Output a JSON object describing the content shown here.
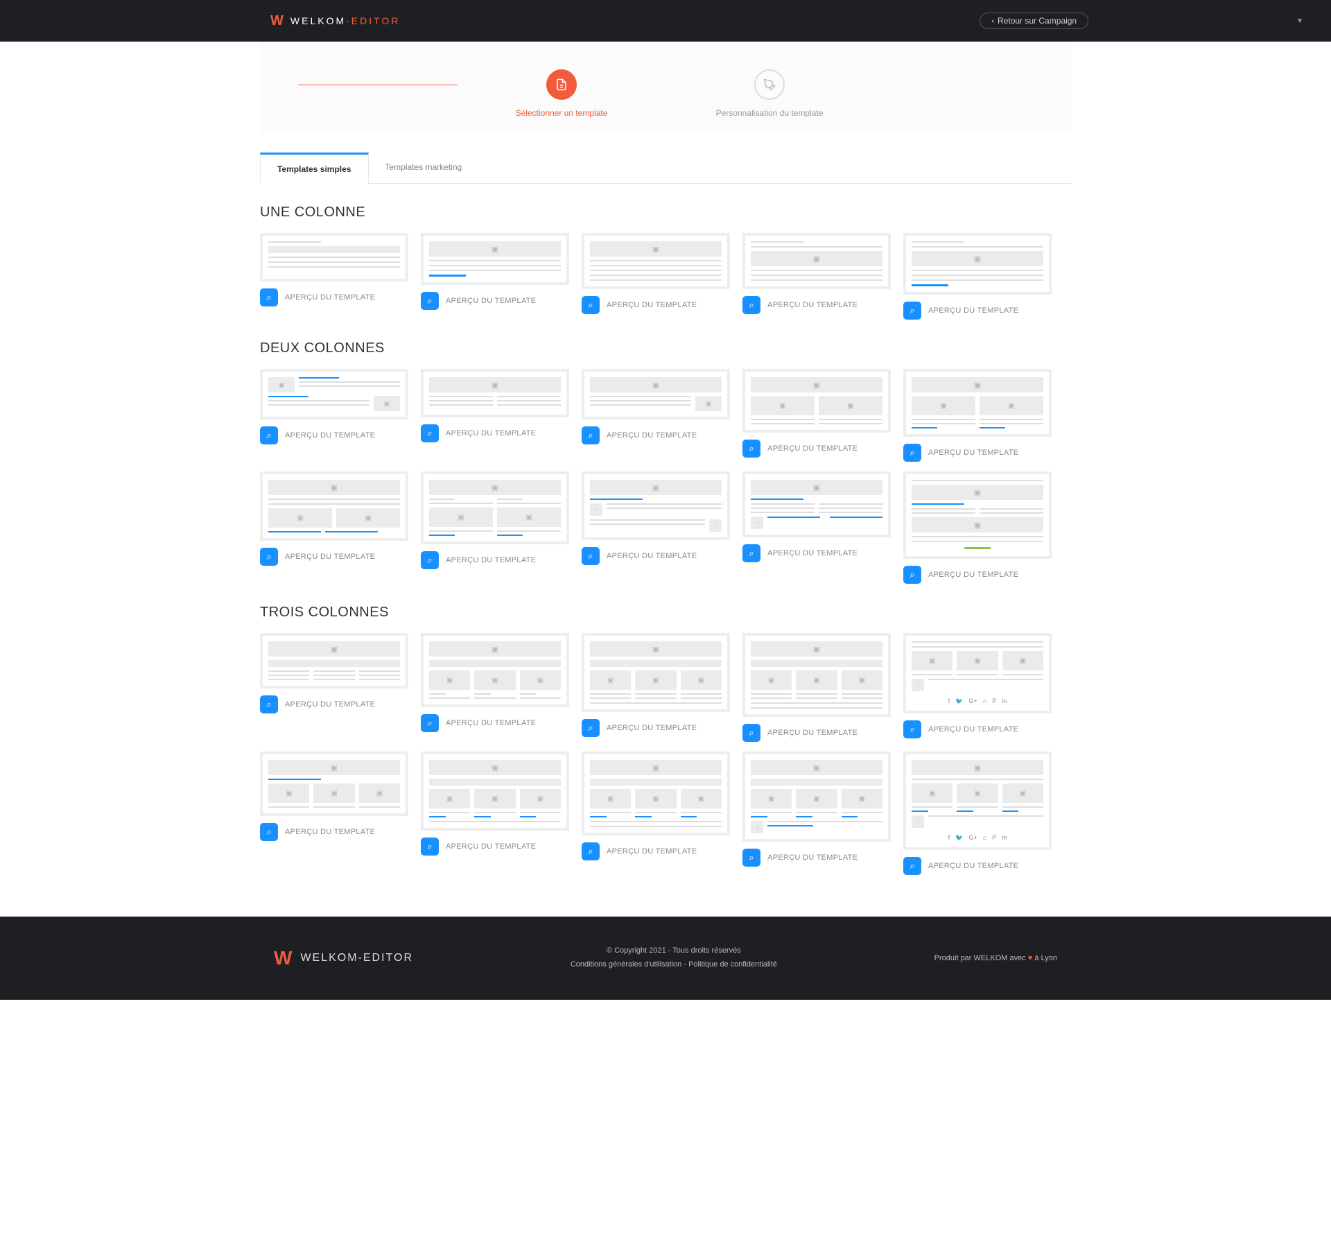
{
  "header": {
    "logo_brand": "WELKOM",
    "logo_suffix": "-EDITOR",
    "return_label": "Retour sur Campaign"
  },
  "stepper": {
    "step1_label": "Sélectionner un template",
    "step2_label": "Personnalisation du template"
  },
  "tabs": {
    "simple": "Templates simples",
    "marketing": "Templates marketing"
  },
  "sections": {
    "one_col": "UNE COLONNE",
    "two_col": "DEUX COLONNES",
    "three_col": "TROIS COLONNES"
  },
  "preview_label": "APERÇU DU TEMPLATE",
  "footer": {
    "brand": "WELKOM-EDITOR",
    "copyright": "© Copyright 2021 - Tous droits réservés",
    "terms": "Conditions générales d'utilisation",
    "privacy": "Politique de confidentialité",
    "separator": " - ",
    "produced_prefix": "Produit par WELKOM avec ",
    "produced_suffix": " à Lyon"
  }
}
